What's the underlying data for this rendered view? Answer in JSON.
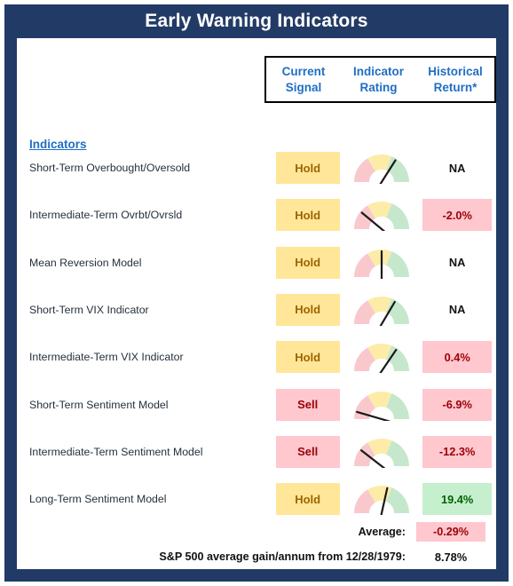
{
  "title": "Early Warning Indicators",
  "colors": {
    "frame_navy": "#223b66",
    "header_blue": "#1f6fc4",
    "hold_bg": "#ffe699",
    "hold_text": "#9c6500",
    "sell_bg": "#ffc7ce",
    "sell_text": "#9c0006",
    "positive_bg": "#c6efce",
    "positive_text": "#006100",
    "gauge_red": "#f9c8cd",
    "gauge_yellow": "#fdeca8",
    "gauge_green": "#c5e8cc",
    "needle": "#1a1a1a"
  },
  "table": {
    "indicators_heading": "Indicators",
    "columns": [
      {
        "line1": "Current",
        "line2": "Signal"
      },
      {
        "line1": "Indicator",
        "line2": "Rating"
      },
      {
        "line1": "Historical",
        "line2": "Return*"
      }
    ],
    "rows": [
      {
        "indicator": "Short-Term Overbought/Oversold",
        "signal": "Hold",
        "signal_state": "hold",
        "gauge_value": 68,
        "return": "NA",
        "return_state": "none"
      },
      {
        "indicator": "Intermediate-Term Ovrbt/Ovrsld",
        "signal": "Hold",
        "signal_state": "hold",
        "gauge_value": 22,
        "return": "-2.0%",
        "return_state": "neg"
      },
      {
        "indicator": "Mean Reversion Model",
        "signal": "Hold",
        "signal_state": "hold",
        "gauge_value": 50,
        "return": "NA",
        "return_state": "none"
      },
      {
        "indicator": "Short-Term VIX Indicator",
        "signal": "Hold",
        "signal_state": "hold",
        "gauge_value": 67,
        "return": "NA",
        "return_state": "none"
      },
      {
        "indicator": "Intermediate-Term VIX Indicator",
        "signal": "Hold",
        "signal_state": "hold",
        "gauge_value": 69,
        "return": "0.4%",
        "return_state": "neg"
      },
      {
        "indicator": "Short-Term Sentiment Model",
        "signal": "Sell",
        "signal_state": "sell",
        "gauge_value": 9,
        "return": "-6.9%",
        "return_state": "neg"
      },
      {
        "indicator": "Intermediate-Term Sentiment Model",
        "signal": "Sell",
        "signal_state": "sell",
        "gauge_value": 21,
        "return": "-12.3%",
        "return_state": "neg"
      },
      {
        "indicator": "Long-Term Sentiment Model",
        "signal": "Hold",
        "signal_state": "hold",
        "gauge_value": 57,
        "return": "19.4%",
        "return_state": "pos"
      }
    ]
  },
  "summary": {
    "average_label": "Average:",
    "average_value": "-0.29%",
    "benchmark_label": "S&P 500 average gain/annum from 12/28/1979:",
    "benchmark_value": "8.78%"
  }
}
